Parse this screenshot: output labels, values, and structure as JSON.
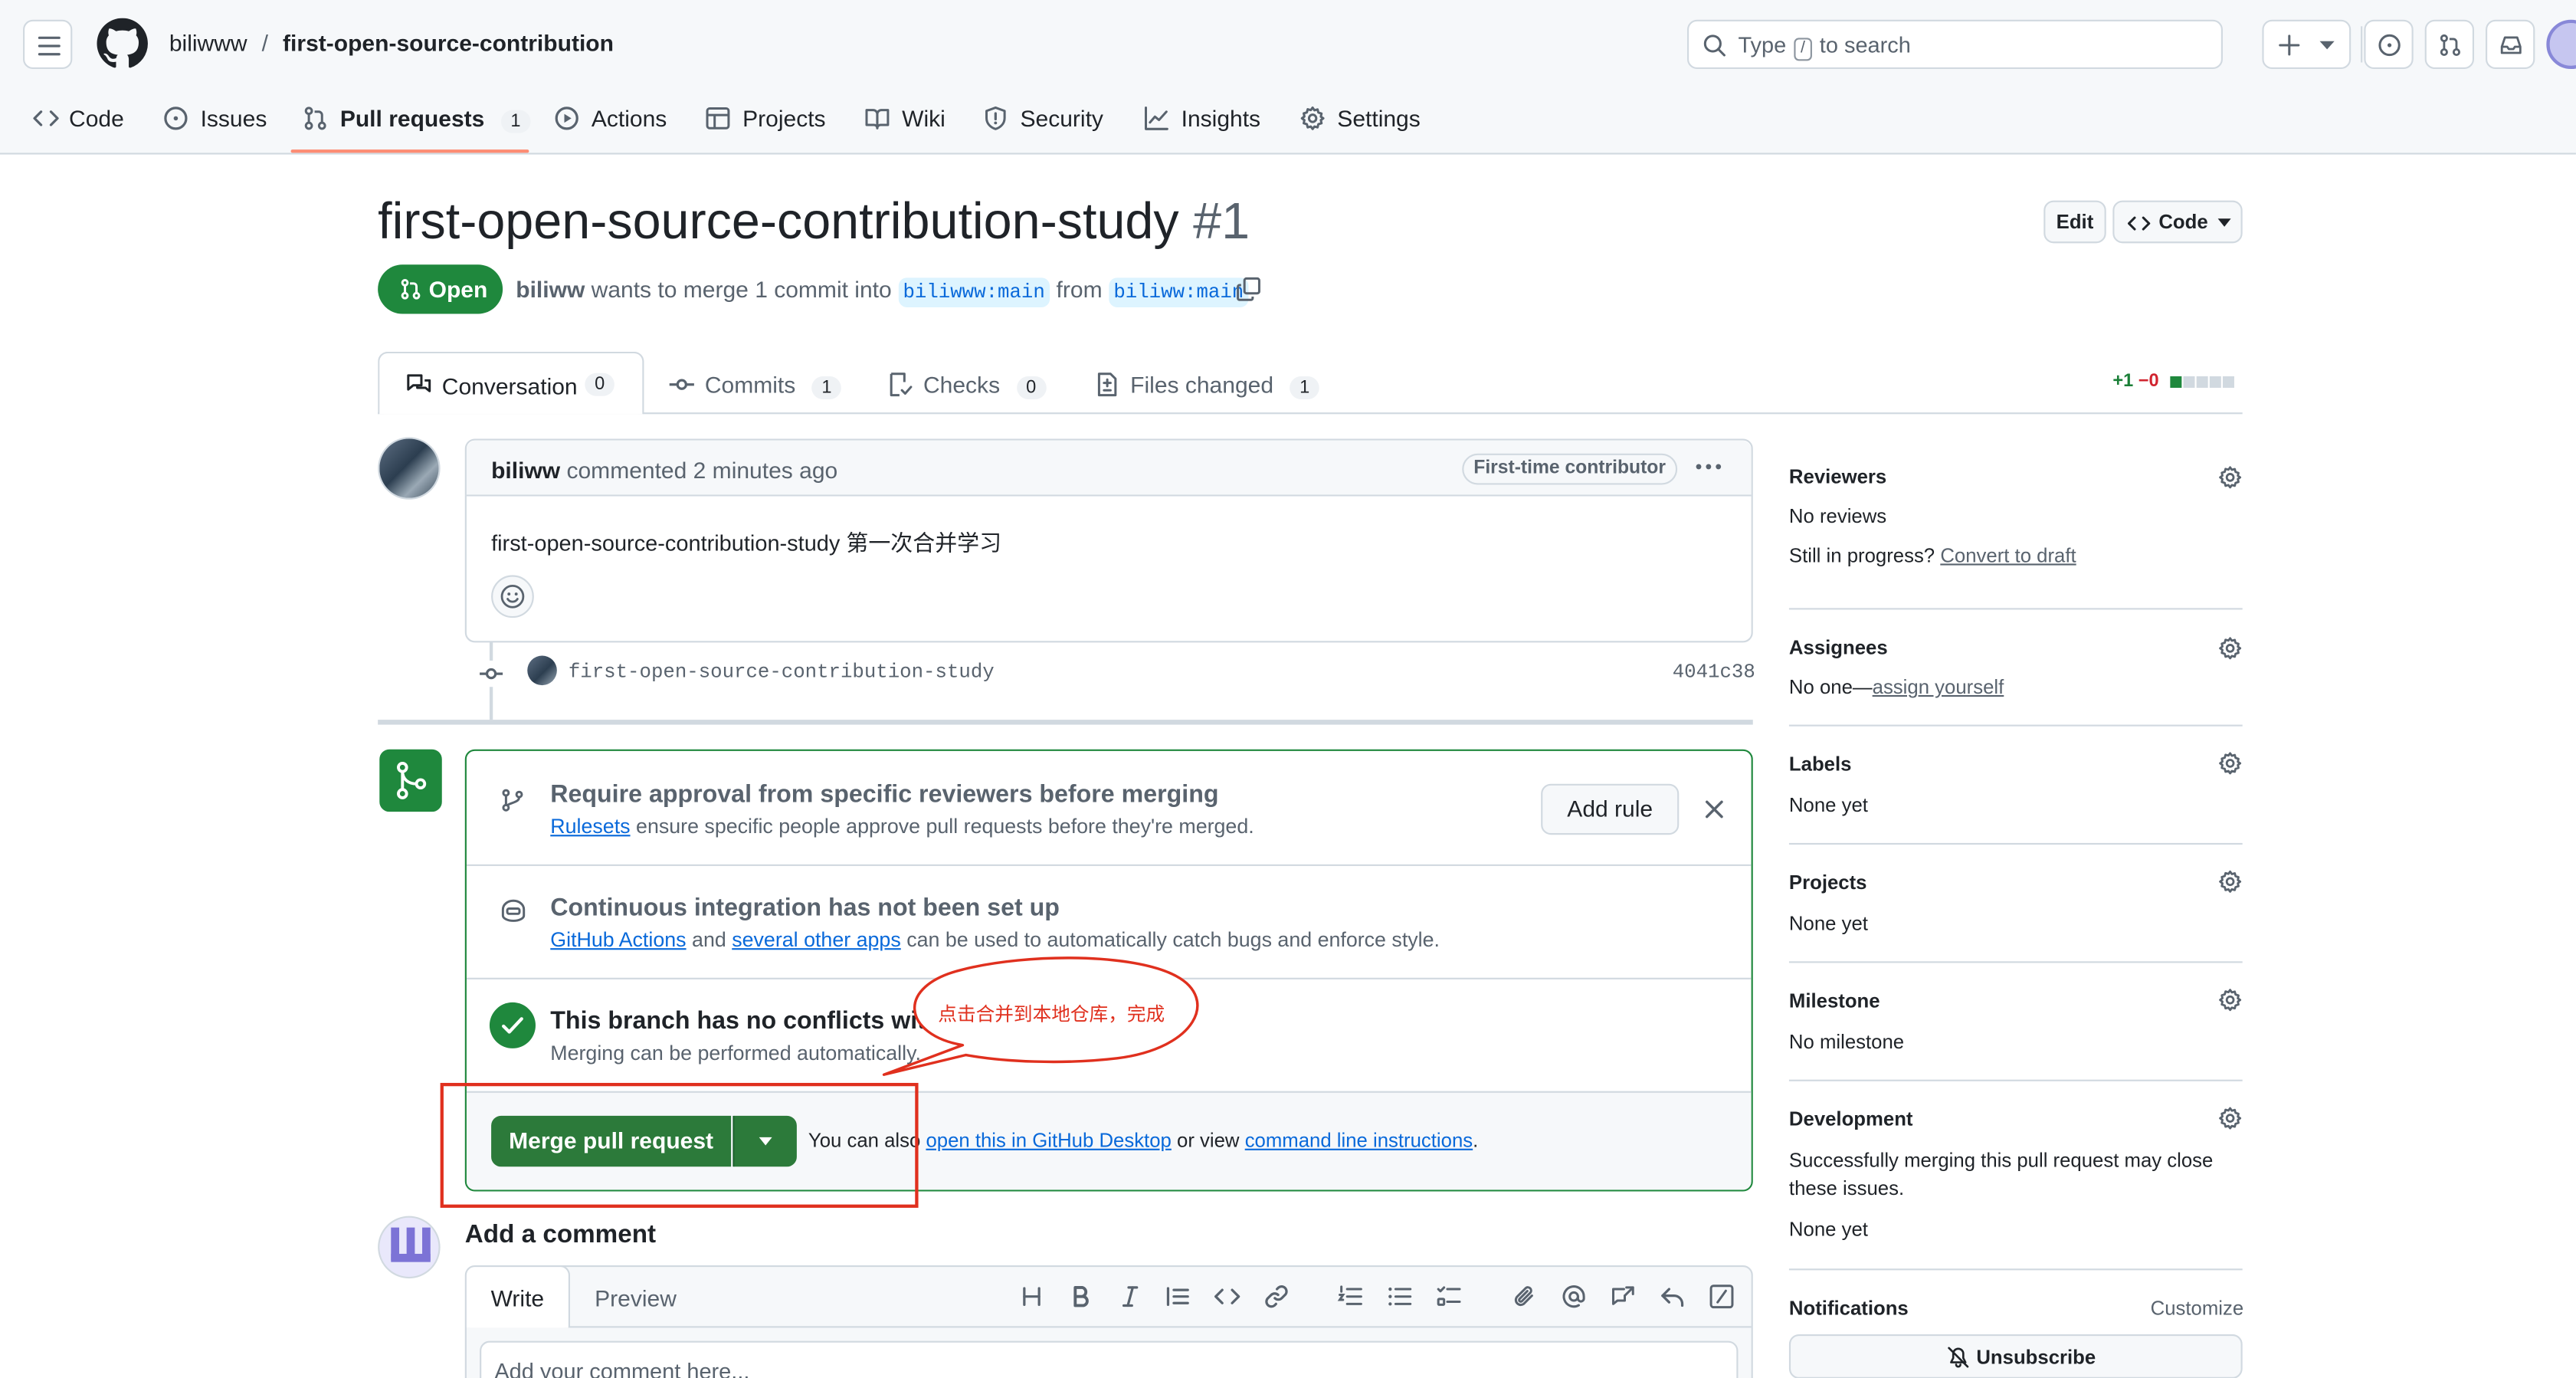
{
  "header": {
    "owner": "biliwww",
    "separator": "/",
    "repo": "first-open-source-contribution",
    "search_placeholder_prefix": "Type",
    "search_key": "/",
    "search_placeholder_suffix": "to search"
  },
  "repo_nav": {
    "code": "Code",
    "issues": "Issues",
    "pull_requests": "Pull requests",
    "pull_requests_count": "1",
    "actions": "Actions",
    "projects": "Projects",
    "wiki": "Wiki",
    "security": "Security",
    "insights": "Insights",
    "settings": "Settings"
  },
  "pr": {
    "title": "first-open-source-contribution-study",
    "number": "#1",
    "edit_label": "Edit",
    "code_label": "Code",
    "state": "Open",
    "author": "biliww",
    "merge_text": "wants to merge 1 commit into",
    "base_branch": "biliwww:main",
    "from_text": "from",
    "head_branch": "biliww:main"
  },
  "tabs": {
    "conversation": "Conversation",
    "conversation_count": "0",
    "commits": "Commits",
    "commits_count": "1",
    "checks": "Checks",
    "checks_count": "0",
    "files": "Files changed",
    "files_count": "1",
    "additions": "+1",
    "deletions": "−0"
  },
  "comment": {
    "author": "biliww",
    "action": "commented 2 minutes ago",
    "badge": "First-time contributor",
    "body": "first-open-source-contribution-study 第一次合并学习"
  },
  "commit": {
    "message": "first-open-source-contribution-study",
    "sha": "4041c38"
  },
  "merge_box": {
    "rule_title": "Require approval from specific reviewers before merging",
    "rule_link": "Rulesets",
    "rule_desc": "ensure specific people approve pull requests before they're merged.",
    "add_rule": "Add rule",
    "ci_title": "Continuous integration has not been set up",
    "ci_link1": "GitHub Actions",
    "ci_and": "and",
    "ci_link2": "several other apps",
    "ci_desc": "can be used to automatically catch bugs and enforce style.",
    "conflict_title": "This branch has no conflicts with the base branch",
    "conflict_desc": "Merging can be performed automatically.",
    "merge_button": "Merge pull request",
    "also_text": "You can also",
    "desktop_link": "open this in GitHub Desktop",
    "or_view": "or view",
    "cli_link": "command line instructions",
    "period": "."
  },
  "annotation": {
    "callout_text": "点击合并到本地仓库，完成",
    "color": "#e0301e"
  },
  "add_comment": {
    "heading": "Add a comment",
    "write_tab": "Write",
    "preview_tab": "Preview",
    "placeholder": "Add your comment here..."
  },
  "sidebar": {
    "reviewers_title": "Reviewers",
    "reviewers_value": "No reviews",
    "in_progress": "Still in progress?",
    "convert_draft": "Convert to draft",
    "assignees_title": "Assignees",
    "assignees_value": "No one—",
    "assign_yourself": "assign yourself",
    "labels_title": "Labels",
    "labels_value": "None yet",
    "projects_title": "Projects",
    "projects_value": "None yet",
    "milestone_title": "Milestone",
    "milestone_value": "No milestone",
    "development_title": "Development",
    "development_desc": "Successfully merging this pull request may close these issues.",
    "development_value": "None yet",
    "notifications_title": "Notifications",
    "customize": "Customize",
    "unsubscribe": "Unsubscribe"
  },
  "colors": {
    "open_green": "#1f883d",
    "merge_green": "#2c7a3a",
    "link_blue": "#0969da",
    "underline_orange": "#fd8c73",
    "deletion_red": "#d1242f"
  }
}
